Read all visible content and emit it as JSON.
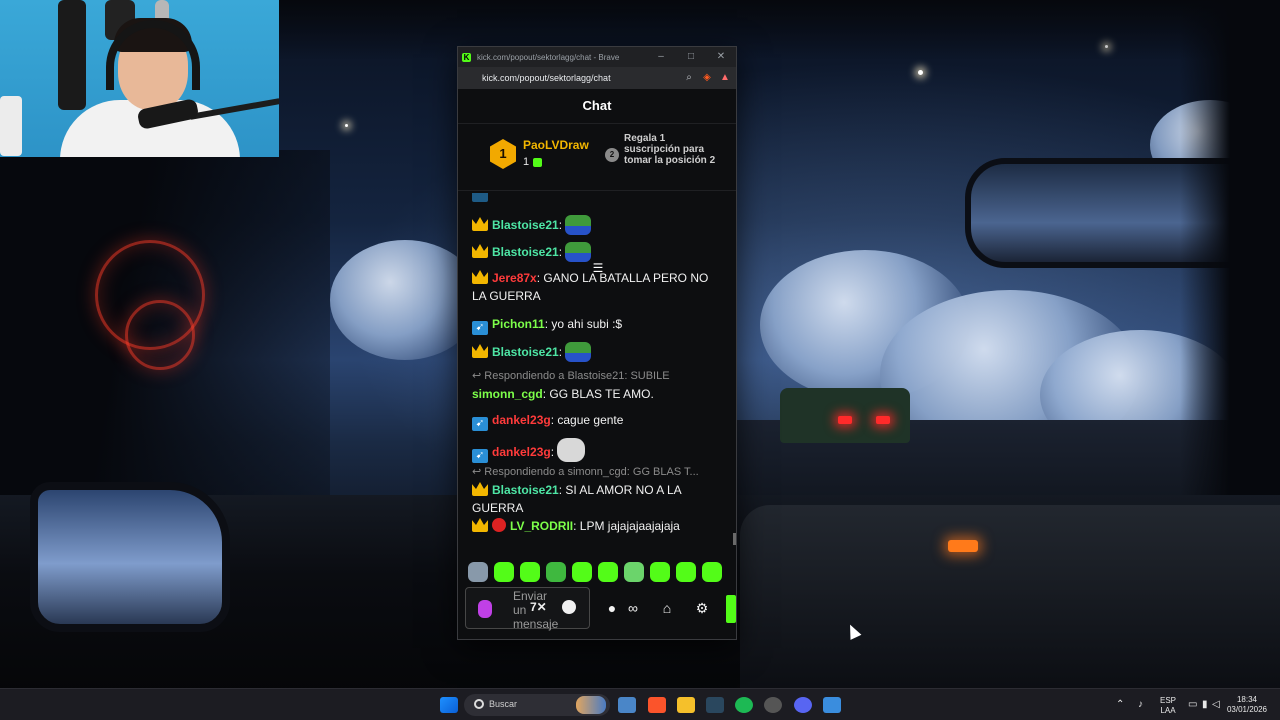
{
  "browser": {
    "window_title": "kick.com/popout/sektorlagg/chat - Brave",
    "url": "kick.com/popout/sektorlagg/chat",
    "window_controls": [
      "–",
      "□",
      "✕"
    ]
  },
  "chat": {
    "header": "Chat",
    "leaderboard": {
      "rank": "1",
      "name": "PaoLVDraw",
      "count": "1",
      "next_rank": "2",
      "gift_text": "Regala 1 suscripción para tomar la posición 2"
    },
    "messages": [
      {
        "user": "Blastoise21",
        "color": "#4ee6a5",
        "badge": "crown",
        "text": "",
        "emote": "pepe"
      },
      {
        "user": "Blastoise21",
        "color": "#4ee6a5",
        "badge": "crown",
        "text": "",
        "emote": "pepe"
      },
      {
        "user": "Jere87x",
        "color": "#ff3b3b",
        "badge": "crown",
        "text": "GANO LA BATALLA PERO NO LA GUERRA"
      },
      {
        "user": "Pichon11",
        "color": "#7dff4a",
        "badge": "sub",
        "text": "yo ahi subi :$"
      },
      {
        "user": "Blastoise21",
        "color": "#4ee6a5",
        "badge": "crown",
        "text": "",
        "emote": "pepe"
      },
      {
        "reply": "Respondiendo a Blastoise21: SUBILE",
        "user": "simonn_cgd",
        "color": "#7dff4a",
        "badge": "none",
        "text": "GG BLAS TE AMO."
      },
      {
        "user": "dankel23g",
        "color": "#ff3b3b",
        "badge": "sub",
        "text": "cague gente"
      },
      {
        "user": "dankel23g",
        "color": "#ff3b3b",
        "badge": "sub",
        "text": "",
        "emote": "cat"
      },
      {
        "reply": "Respondiendo a simonn_cgd: GG BLAS T...",
        "user": "Blastoise21",
        "color": "#4ee6a5",
        "badge": "crown",
        "text": "SI AL AMOR NO A LA GUERRA"
      },
      {
        "user": "LV_RODRII",
        "color": "#7dff4a",
        "badge": "crown+red",
        "text": "LPM jajajajaajajaja"
      }
    ],
    "composer": {
      "placeholder": "Enviar un mensaje",
      "infinity": "∞"
    }
  },
  "taskbar": {
    "search_placeholder": "Buscar",
    "lang_top": "ESP",
    "lang_bottom": "LAA",
    "time": "18:34",
    "date": "03/01/2026"
  },
  "colors": {
    "kick_green": "#53fc18",
    "gold": "#f2b600",
    "chat_bg": "#0d0e10"
  }
}
